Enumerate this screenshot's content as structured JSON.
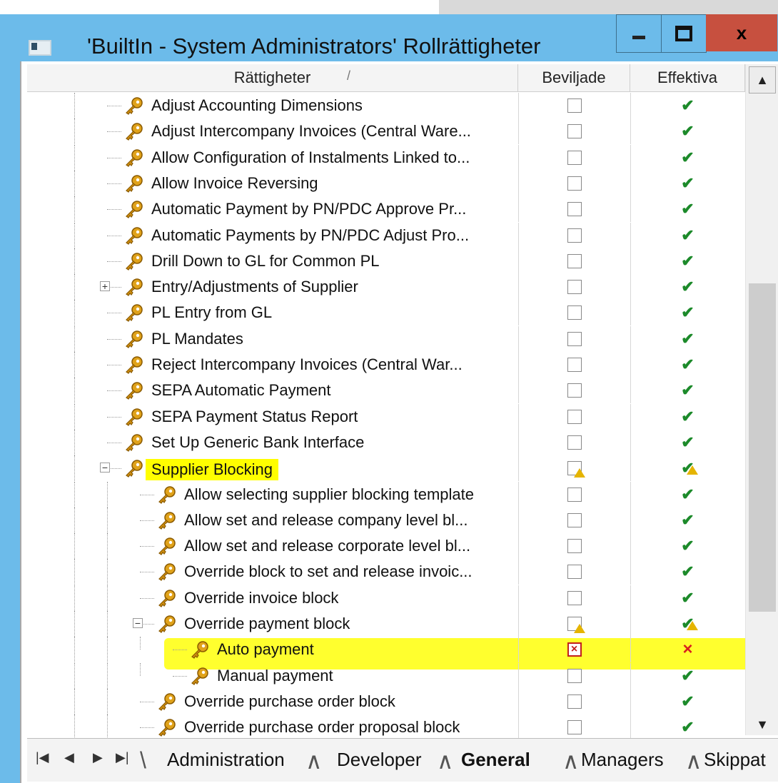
{
  "window": {
    "title": "'BuiltIn - System Administrators' Rollrättigheter",
    "min_glyph": "",
    "close_glyph": "x"
  },
  "table": {
    "columns": {
      "name": "Rättigheter",
      "sort_mark": "/",
      "granted": "Beviljade",
      "effective": "Effektiva"
    },
    "rows": [
      {
        "label": "Adjust Accounting Dimensions",
        "level": 0,
        "expander": "",
        "granted": "empty",
        "effective": "tick"
      },
      {
        "label": "Adjust Intercompany Invoices (Central Ware...",
        "level": 0,
        "expander": "",
        "granted": "empty",
        "effective": "tick"
      },
      {
        "label": "Allow Configuration of Instalments Linked to...",
        "level": 0,
        "expander": "",
        "granted": "empty",
        "effective": "tick"
      },
      {
        "label": "Allow Invoice Reversing",
        "level": 0,
        "expander": "",
        "granted": "empty",
        "effective": "tick"
      },
      {
        "label": "Automatic Payment by PN/PDC Approve Pr...",
        "level": 0,
        "expander": "",
        "granted": "empty",
        "effective": "tick"
      },
      {
        "label": "Automatic Payments by PN/PDC Adjust Pro...",
        "level": 0,
        "expander": "",
        "granted": "empty",
        "effective": "tick"
      },
      {
        "label": "Drill Down to GL for Common PL",
        "level": 0,
        "expander": "",
        "granted": "empty",
        "effective": "tick"
      },
      {
        "label": "Entry/Adjustments of Supplier",
        "level": 0,
        "expander": "+",
        "granted": "empty",
        "effective": "tick"
      },
      {
        "label": "PL Entry from GL",
        "level": 0,
        "expander": "",
        "granted": "empty",
        "effective": "tick"
      },
      {
        "label": "PL Mandates",
        "level": 0,
        "expander": "",
        "granted": "empty",
        "effective": "tick"
      },
      {
        "label": "Reject Intercompany Invoices (Central War...",
        "level": 0,
        "expander": "",
        "granted": "empty",
        "effective": "tick"
      },
      {
        "label": "SEPA Automatic Payment",
        "level": 0,
        "expander": "",
        "granted": "empty",
        "effective": "tick"
      },
      {
        "label": "SEPA Payment Status Report",
        "level": 0,
        "expander": "",
        "granted": "empty",
        "effective": "tick"
      },
      {
        "label": "Set Up Generic Bank Interface",
        "level": 0,
        "expander": "",
        "granted": "empty",
        "effective": "tick"
      },
      {
        "label": "Supplier Blocking",
        "level": 0,
        "expander": "−",
        "granted": "warn",
        "effective": "tickwarn",
        "highlight": true
      },
      {
        "label": "Allow selecting supplier blocking template",
        "level": 1,
        "expander": "",
        "granted": "empty",
        "effective": "tick"
      },
      {
        "label": "Allow set and release company level bl...",
        "level": 1,
        "expander": "",
        "granted": "empty",
        "effective": "tick"
      },
      {
        "label": "Allow set and release corporate level bl...",
        "level": 1,
        "expander": "",
        "granted": "empty",
        "effective": "tick"
      },
      {
        "label": "Override block to set and release invoic...",
        "level": 1,
        "expander": "",
        "granted": "empty",
        "effective": "tick"
      },
      {
        "label": "Override invoice block",
        "level": 1,
        "expander": "",
        "granted": "empty",
        "effective": "tick"
      },
      {
        "label": "Override payment block",
        "level": 1,
        "expander": "−",
        "granted": "warn",
        "effective": "tickwarn"
      },
      {
        "label": "Auto payment",
        "level": 2,
        "expander": "",
        "granted": "denied",
        "effective": "cross",
        "band": true
      },
      {
        "label": "Manual payment",
        "level": 2,
        "expander": "",
        "granted": "empty",
        "effective": "tick"
      },
      {
        "label": "Override purchase order block",
        "level": 1,
        "expander": "",
        "granted": "empty",
        "effective": "tick"
      },
      {
        "label": "Override purchase order proposal block",
        "level": 1,
        "expander": "",
        "granted": "empty",
        "effective": "tick"
      }
    ]
  },
  "scrollbar": {
    "up": "▲",
    "down": "▼"
  },
  "tabs": {
    "nav": [
      "|◀",
      "◀",
      "▶",
      "▶|"
    ],
    "items": [
      {
        "label": "Administration",
        "active": false
      },
      {
        "label": "Developer",
        "active": false
      },
      {
        "label": "General",
        "active": true
      },
      {
        "label": "Managers",
        "active": false
      },
      {
        "label": "Skippat",
        "active": false
      }
    ]
  }
}
